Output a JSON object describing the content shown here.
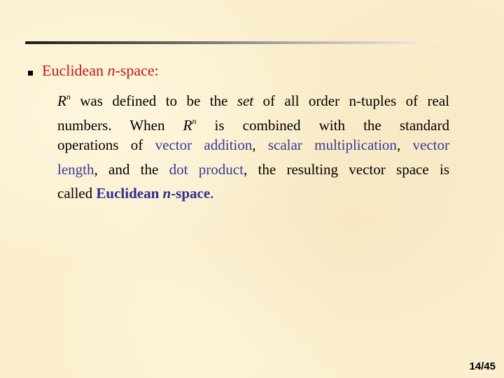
{
  "slide": {
    "heading": {
      "prefix": "Euclidean ",
      "italic": "n",
      "suffix": "-space:"
    },
    "paragraph": {
      "line1": {
        "R": "R",
        "sup": "n",
        "text_a": " was defined to be the ",
        "italic": "set",
        "text_b": " of all order n-tuples of real"
      },
      "line2": {
        "text_a": "numbers. When ",
        "R": "R",
        "sup": "n",
        "text_b": " is combined with the standard"
      },
      "line3": {
        "text_a": "operations of ",
        "term1": "vector addition",
        "sep1": ", ",
        "term2": "scalar multiplication",
        "sep2": ", ",
        "term3a": "vector"
      },
      "line4": {
        "term3b": "length",
        "text_a": ", and the ",
        "term4": "dot product",
        "text_b": ", the resulting vector space is"
      },
      "line5": {
        "text_a": "called ",
        "bold_a": "Euclidean ",
        "bold_italic": "n",
        "bold_b": "-space",
        "end": "."
      }
    },
    "page_number": "14/45"
  },
  "colors": {
    "heading": "#c0161e",
    "term": "#3a3a96",
    "background": "#fbefcf"
  }
}
